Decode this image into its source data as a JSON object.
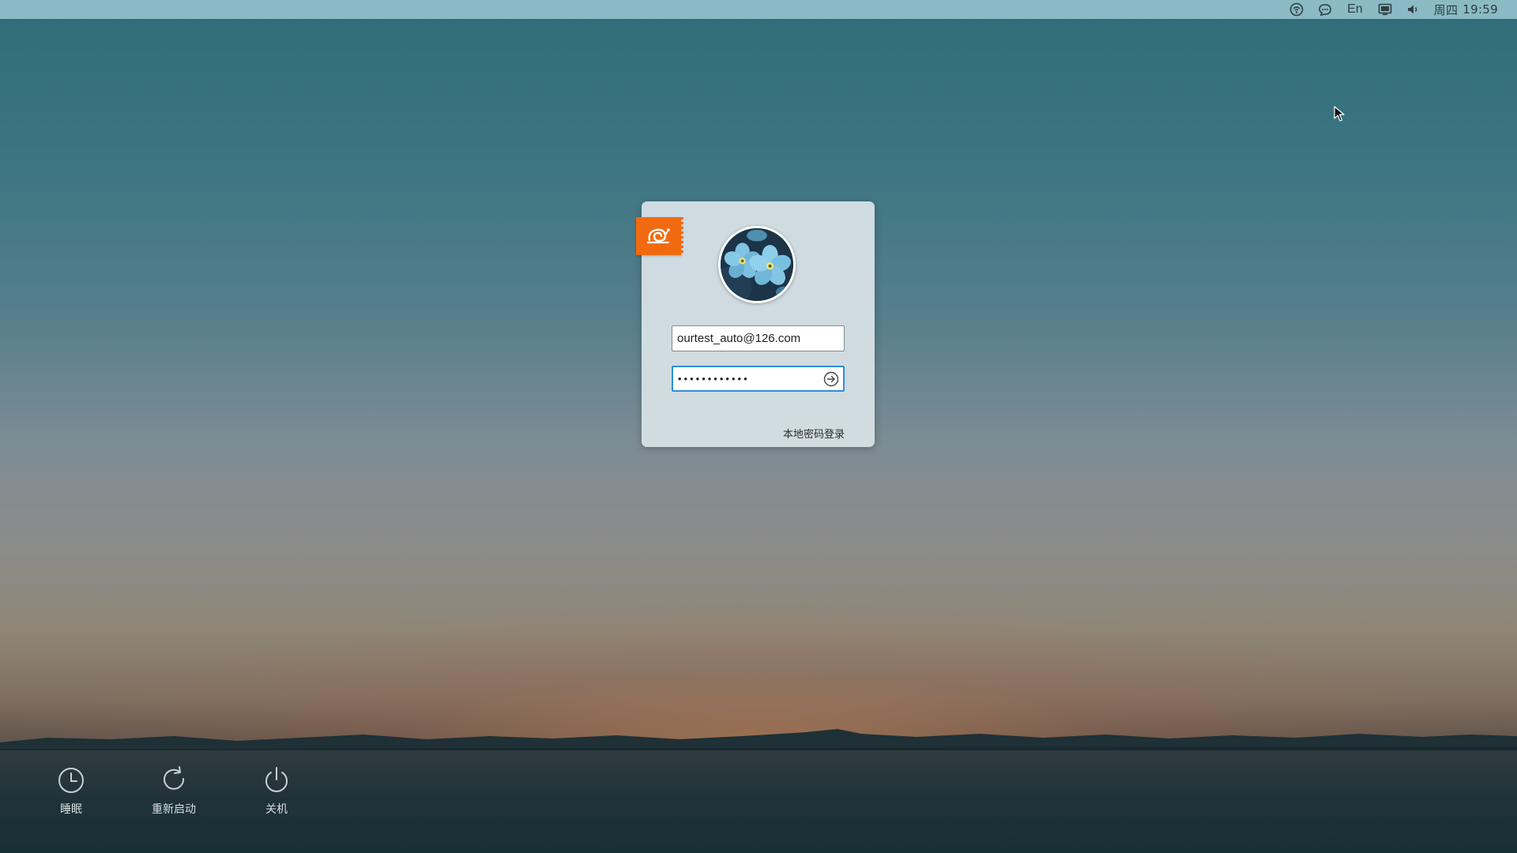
{
  "tray": {
    "icons": [
      "network-icon",
      "chat-icon",
      "display-icon",
      "volume-icon"
    ],
    "language": "En",
    "weekday": "周四",
    "time": "19:59"
  },
  "login": {
    "brand_icon": "snail-logo-icon",
    "avatar_icon": "forget-me-not-flower-avatar",
    "username": "ourtest_auto@126.com",
    "password_masked": "••••••••••••",
    "submit_icon": "arrow-right-circle-icon",
    "local_login_label": "本地密码登录"
  },
  "power": {
    "sleep_label": "睡眠",
    "restart_label": "重新启动",
    "shutdown_label": "关机"
  },
  "colors": {
    "brand_orange": "#f26a10",
    "focus_blue": "#2f8fdc",
    "panel_bg": "#9bc8d2"
  }
}
